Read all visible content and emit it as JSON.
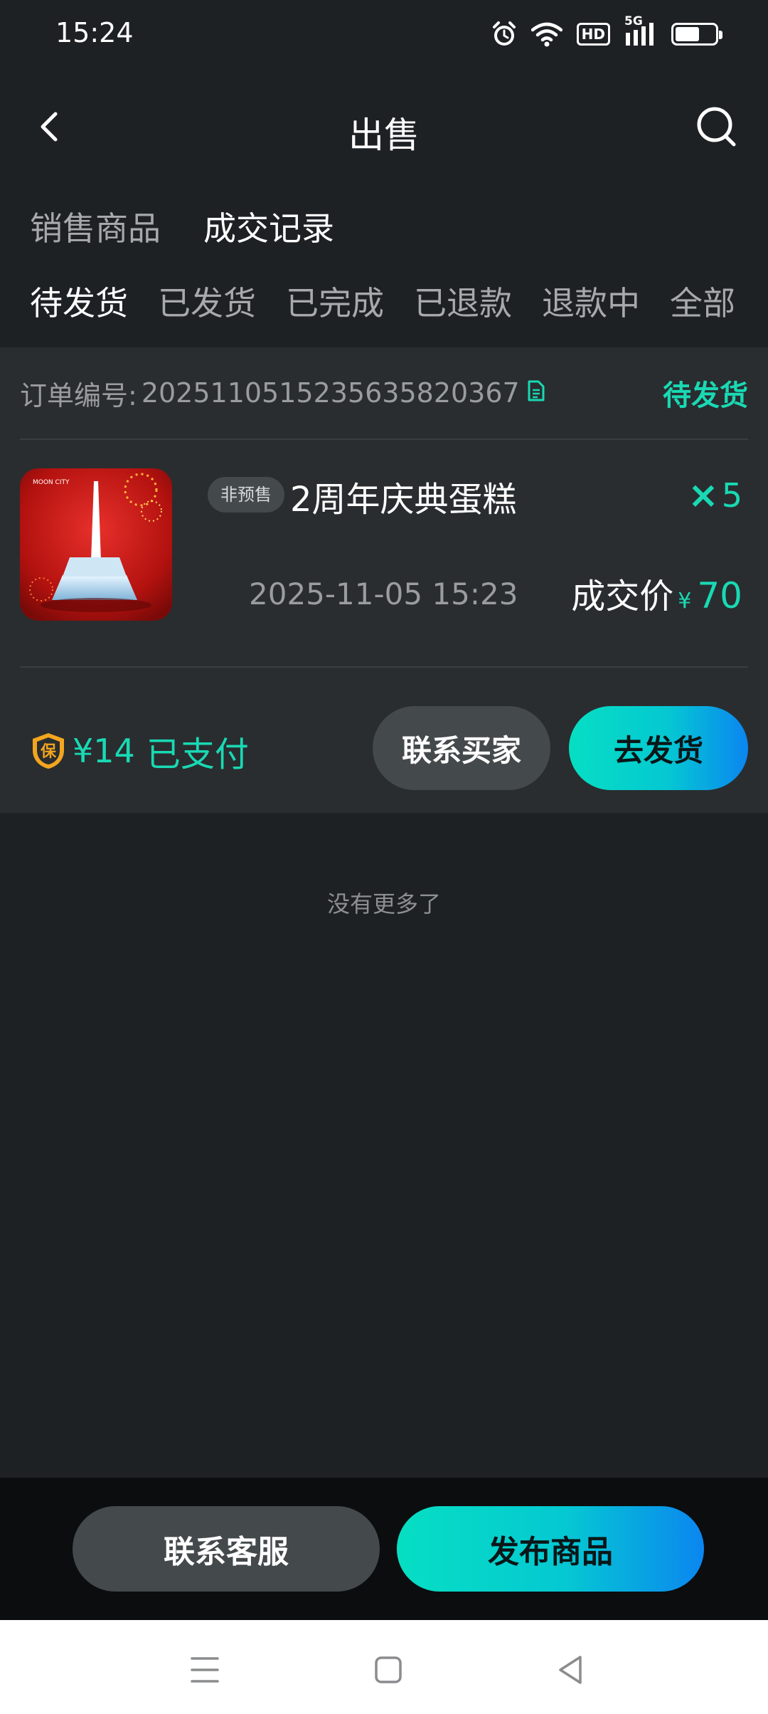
{
  "status_bar": {
    "time": "15:24",
    "icons": [
      "alarm-icon",
      "wifi-icon",
      "hd-icon",
      "signal-5g-icon",
      "battery-icon"
    ],
    "hd_label": "HD",
    "network_label": "5G"
  },
  "header": {
    "title": "出售",
    "back_icon": "chevron-left-icon",
    "search_icon": "search-icon"
  },
  "main_tabs": [
    {
      "label": "销售商品",
      "active": false
    },
    {
      "label": "成交记录",
      "active": true
    }
  ],
  "sub_tabs": [
    {
      "label": "待发货",
      "active": true
    },
    {
      "label": "已发货",
      "active": false
    },
    {
      "label": "已完成",
      "active": false
    },
    {
      "label": "已退款",
      "active": false
    },
    {
      "label": "退款中",
      "active": false
    },
    {
      "label": "全部",
      "active": false
    }
  ],
  "order": {
    "order_no_label": "订单编号:",
    "order_no": "2025110515235635820367",
    "status": "待发货",
    "product": {
      "tag": "非预售",
      "name": "2周年庆典蛋糕",
      "quantity_prefix": "×",
      "quantity": "5",
      "deal_time": "2025-11-05 15:23",
      "price_label": "成交价",
      "currency": "¥",
      "price": "70"
    },
    "deposit": {
      "shield_text": "保",
      "amount": "¥14",
      "paid_label": "已支付"
    },
    "buttons": {
      "contact_buyer": "联系买家",
      "ship": "去发货"
    }
  },
  "list_footer": "没有更多了",
  "bottom_bar": {
    "service_label": "联系客服",
    "publish_label": "发布商品"
  },
  "nav_bar": {
    "icons": [
      "menu-icon",
      "home-square-icon",
      "back-triangle-icon"
    ]
  },
  "colors": {
    "background": "#1e2124",
    "card": "#292d2f",
    "accent": "#19d9b4",
    "gradient_start": "#06dfc3",
    "gradient_end": "#0b86f0"
  }
}
